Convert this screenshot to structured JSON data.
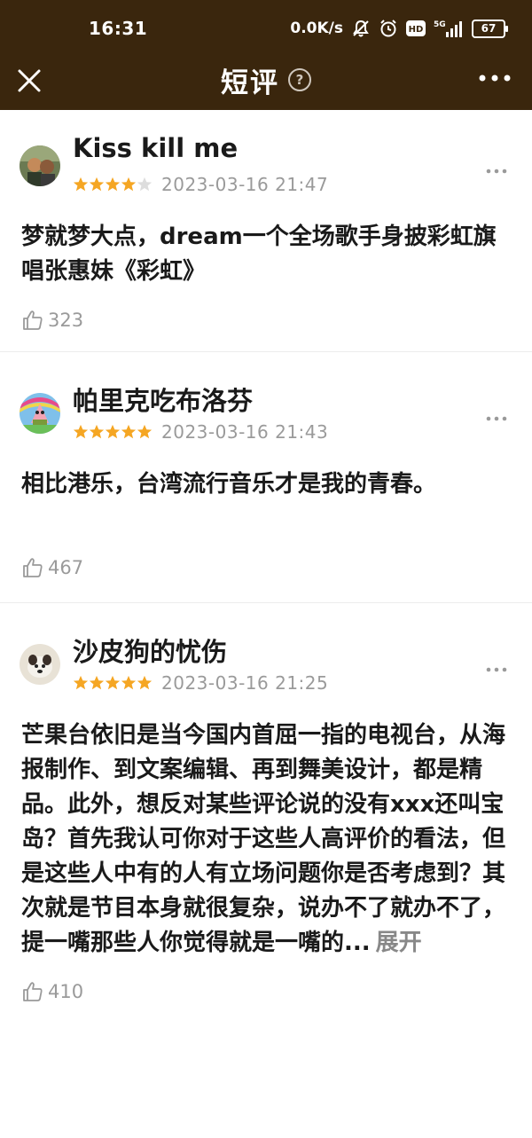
{
  "status_bar": {
    "time": "16:31",
    "net_speed": "0.0K/s",
    "battery": "67",
    "hd_label": "HD",
    "signal_label": "5G",
    "icons": [
      "mute-icon",
      "alarm-icon",
      "hd-icon",
      "signal-icon",
      "battery-icon"
    ]
  },
  "nav": {
    "title": "短评",
    "help_symbol": "?",
    "icons": [
      "close-icon",
      "help-icon",
      "more-icon"
    ]
  },
  "colors": {
    "header_bg": "#3a260d",
    "star_on": "#f5a623",
    "star_off": "#dddddd",
    "muted_text": "#9a9a9a"
  },
  "reviews": [
    {
      "username": "Kiss kill me",
      "rating": 4,
      "date": "2023-03-16 21:47",
      "content": "梦就梦大点，dream一个全场歌手身披彩虹旗唱张惠妹《彩虹》",
      "likes": "323"
    },
    {
      "username": "帕里克吃布洛芬",
      "rating": 5,
      "date": "2023-03-16 21:43",
      "content": "相比港乐，台湾流行音乐才是我的青春。",
      "likes": "467"
    },
    {
      "username": "沙皮狗的忧伤",
      "rating": 5,
      "date": "2023-03-16 21:25",
      "content": "芒果台依旧是当今国内首屈一指的电视台，从海报制作、到文案编辑、再到舞美设计，都是精品。此外，想反对某些评论说的没有xxx还叫宝岛？首先我认可你对于这些人高评价的看法，但是这些人中有的人有立场问题你是否考虑到？其次就是节目本身就很复杂，说办不了就办不了，提一嘴那些人你觉得就是一嘴的...",
      "expand_label": "展开",
      "likes": "410"
    }
  ]
}
